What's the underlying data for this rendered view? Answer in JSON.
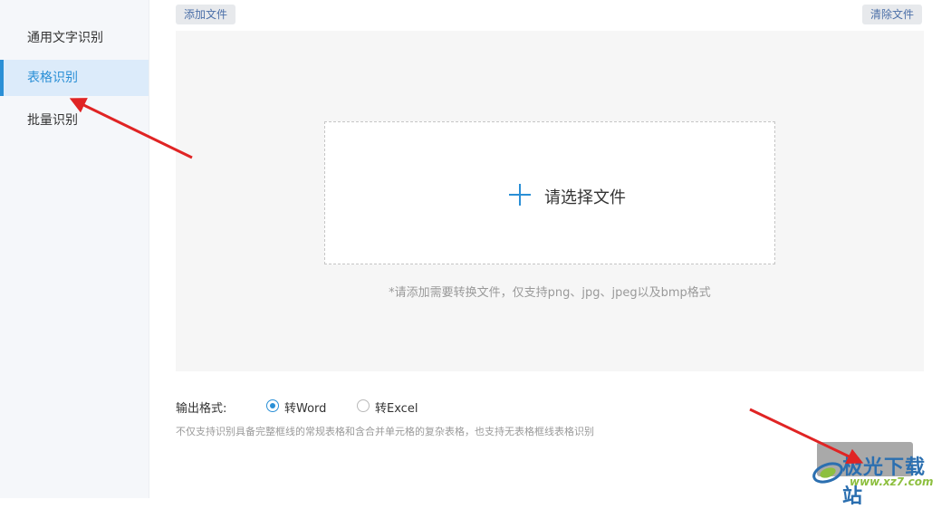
{
  "sidebar": {
    "items": [
      {
        "label": "通用文字识别",
        "active": false
      },
      {
        "label": "表格识别",
        "active": true
      },
      {
        "label": "批量识别",
        "active": false
      }
    ]
  },
  "toolbar": {
    "add_file_label": "添加文件",
    "clear_file_label": "清除文件"
  },
  "dropzone": {
    "label": "请选择文件",
    "hint": "*请添加需要转换文件，仅支持png、jpg、jpeg以及bmp格式"
  },
  "output": {
    "label": "输出格式:",
    "options": [
      {
        "label": "转Word",
        "selected": true
      },
      {
        "label": "转Excel",
        "selected": false
      }
    ],
    "description": "不仅支持识别具备完整框线的常规表格和含合并单元格的复杂表格，也支持无表格框线表格识别"
  },
  "watermark": {
    "text": "极光下载站",
    "url": "www.xz7.com"
  },
  "colors": {
    "accent": "#2a8fd6",
    "arrow": "#e02424",
    "sidebar_bg": "#f5f7fa",
    "active_bg": "#dcebfa",
    "panel_bg": "#f6f6f6",
    "start_button_bg": "#a9a9a9"
  },
  "icons": [
    "plus-icon",
    "watermark-logo-icon"
  ]
}
